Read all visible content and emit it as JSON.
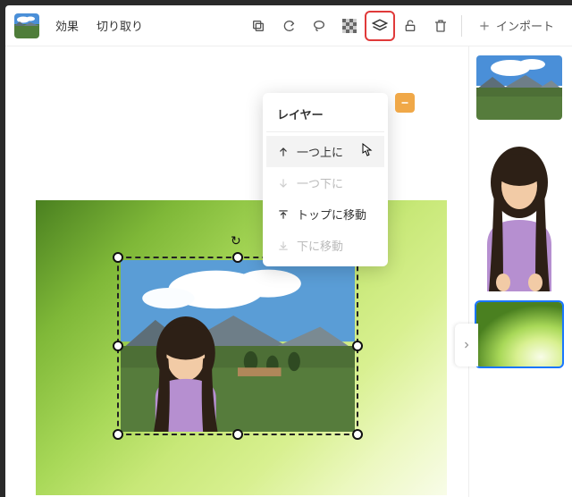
{
  "topbar": {
    "effects": "効果",
    "crop": "切り取り",
    "import": "インポート"
  },
  "popover": {
    "title": "レイヤー",
    "items": [
      {
        "label": "一つ上に",
        "state": "hover"
      },
      {
        "label": "一つ下に",
        "state": "disabled"
      },
      {
        "label": "トップに移動",
        "state": "normal"
      },
      {
        "label": "下に移動",
        "state": "disabled"
      }
    ]
  },
  "side": {
    "thumbs": [
      {
        "name": "landscape-layer",
        "selected": false
      },
      {
        "name": "person-layer",
        "selected": false
      },
      {
        "name": "background-layer",
        "selected": true
      }
    ]
  },
  "icons": {
    "copy": "copy-icon",
    "redo": "redo-icon",
    "lasso": "lasso-icon",
    "checker": "checker-icon",
    "layers": "layers-icon",
    "lock": "lock-icon",
    "trash": "trash-icon",
    "plus": "plus-icon"
  }
}
